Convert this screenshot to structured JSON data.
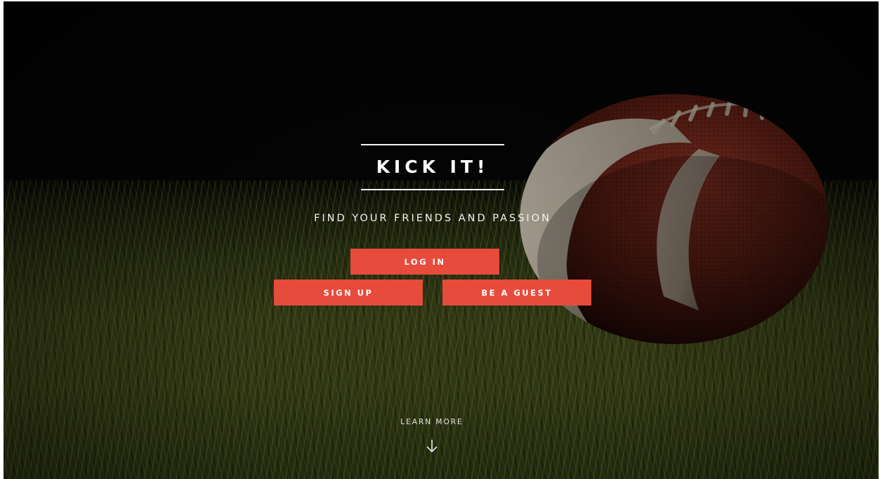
{
  "hero": {
    "title": "KICK IT!",
    "subtitle": "FIND YOUR FRIENDS AND PASSION"
  },
  "buttons": {
    "login_label": "LOG IN",
    "signup_label": "SIGN UP",
    "guest_label": "BE A GUEST"
  },
  "footer": {
    "learn_more_label": "LEARN MORE",
    "learn_more_icon": "arrow-down-icon"
  },
  "colors": {
    "accent": "#e74b3c",
    "text": "#ffffff",
    "background": "#050505"
  },
  "background_image": {
    "subject": "football-on-grass"
  }
}
